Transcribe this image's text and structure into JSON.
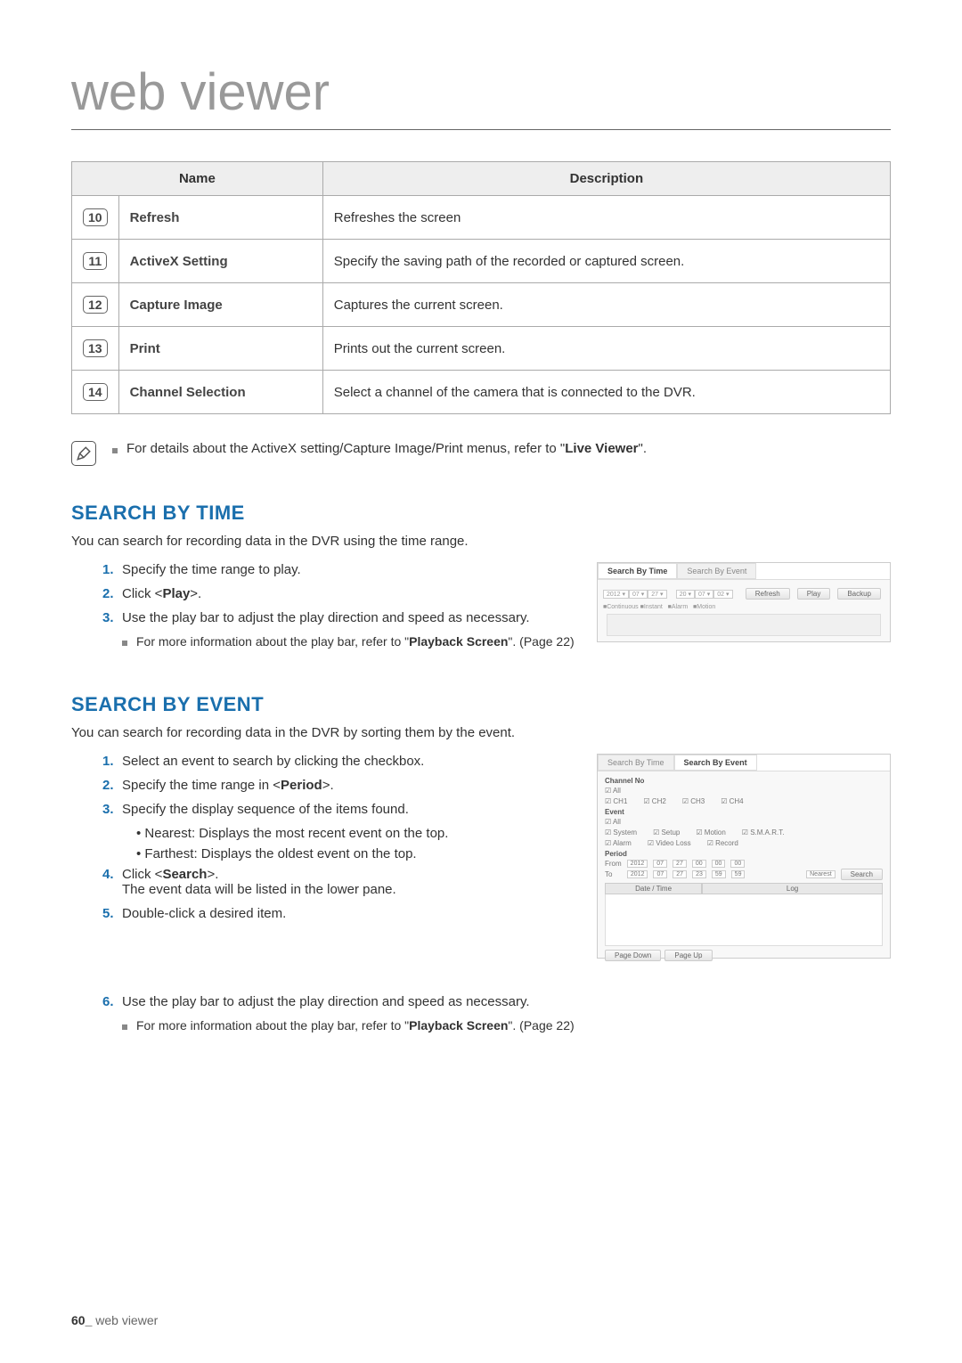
{
  "page": {
    "title": "web viewer",
    "footer_num": "60_",
    "footer_label": "web viewer"
  },
  "table": {
    "header_name": "Name",
    "header_desc": "Description",
    "rows": [
      {
        "num": "10",
        "name": "Refresh",
        "desc": "Refreshes the screen"
      },
      {
        "num": "11",
        "name": "ActiveX Setting",
        "desc": "Specify the saving path of the recorded or captured screen."
      },
      {
        "num": "12",
        "name": "Capture Image",
        "desc": "Captures the current screen."
      },
      {
        "num": "13",
        "name": "Print",
        "desc": "Prints out the current screen."
      },
      {
        "num": "14",
        "name": "Channel Selection",
        "desc": "Select a channel of the camera that is connected to the DVR."
      }
    ]
  },
  "note_main": {
    "prefix": "For details about the ActiveX setting/Capture Image/Print menus, refer to \"",
    "bold": "Live Viewer",
    "suffix": "\"."
  },
  "search_time": {
    "heading": "SEARCH BY TIME",
    "intro": "You can search for recording data in the DVR using the time range.",
    "items": {
      "s1": "Specify the time range to play.",
      "s2_pre": "Click <",
      "s2_bold": "Play",
      "s2_post": ">.",
      "s3": "Use the play bar to adjust the play direction and speed as necessary.",
      "note_pre": "For more information about the play bar, refer to \"",
      "note_bold": "Playback Screen",
      "note_post": "\". (Page 22)"
    },
    "ss": {
      "tab1": "Search By Time",
      "tab2": "Search By Event",
      "btn_refresh": "Refresh",
      "btn_play": "Play",
      "btn_backup": "Backup"
    }
  },
  "search_event": {
    "heading": "SEARCH BY EVENT",
    "intro": "You can search for recording data in the DVR by sorting them by the event.",
    "items": {
      "s1": "Select an event to search by clicking the checkbox.",
      "s2_pre": "Specify the time range in <",
      "s2_bold": "Period",
      "s2_post": ">.",
      "s3": "Specify the display sequence of the items found.",
      "s3a": "• Nearest: Displays the most recent event on the top.",
      "s3b": "• Farthest: Displays the oldest event on the top.",
      "s4_pre": "Click <",
      "s4_bold": "Search",
      "s4_post": ">.",
      "s4_sub": "The event data will be listed in the lower pane.",
      "s5": "Double-click a desired item.",
      "s6": "Use the play bar to adjust the play direction and speed as necessary.",
      "note_pre": "For more information about the play bar, refer to \"",
      "note_bold": "Playback Screen",
      "note_post": "\". (Page 22)"
    },
    "ss": {
      "tab1": "Search By Time",
      "tab2": "Search By Event",
      "label_channel": "Channel No",
      "chk_all": "☑ All",
      "chk_ch1": "☑ CH1",
      "chk_ch2": "☑ CH2",
      "chk_ch3": "☑ CH3",
      "chk_ch4": "☑ CH4",
      "label_event": "Event",
      "chk_eall": "☑ All",
      "chk_system": "☑ System",
      "chk_setup": "☑ Setup",
      "chk_motion": "☑ Motion",
      "chk_smart": "☑ S.M.A.R.T.",
      "chk_alarm": "☑ Alarm",
      "chk_videoloss": "☑ Video Loss",
      "chk_record": "☑ Record",
      "label_period": "Period",
      "from_label": "From",
      "to_label": "To",
      "y1": "2012",
      "m1": "07",
      "d1": "27",
      "h1": "00",
      "mi1": "00",
      "se1": "00",
      "y2": "2012",
      "m2": "07",
      "d2": "27",
      "h2": "23",
      "mi2": "59",
      "se2": "59",
      "sort": "Nearest",
      "btn_search": "Search",
      "hdr_date": "Date / Time",
      "hdr_log": "Log",
      "btn_pagedown": "Page Down",
      "btn_pageup": "Page Up"
    }
  }
}
